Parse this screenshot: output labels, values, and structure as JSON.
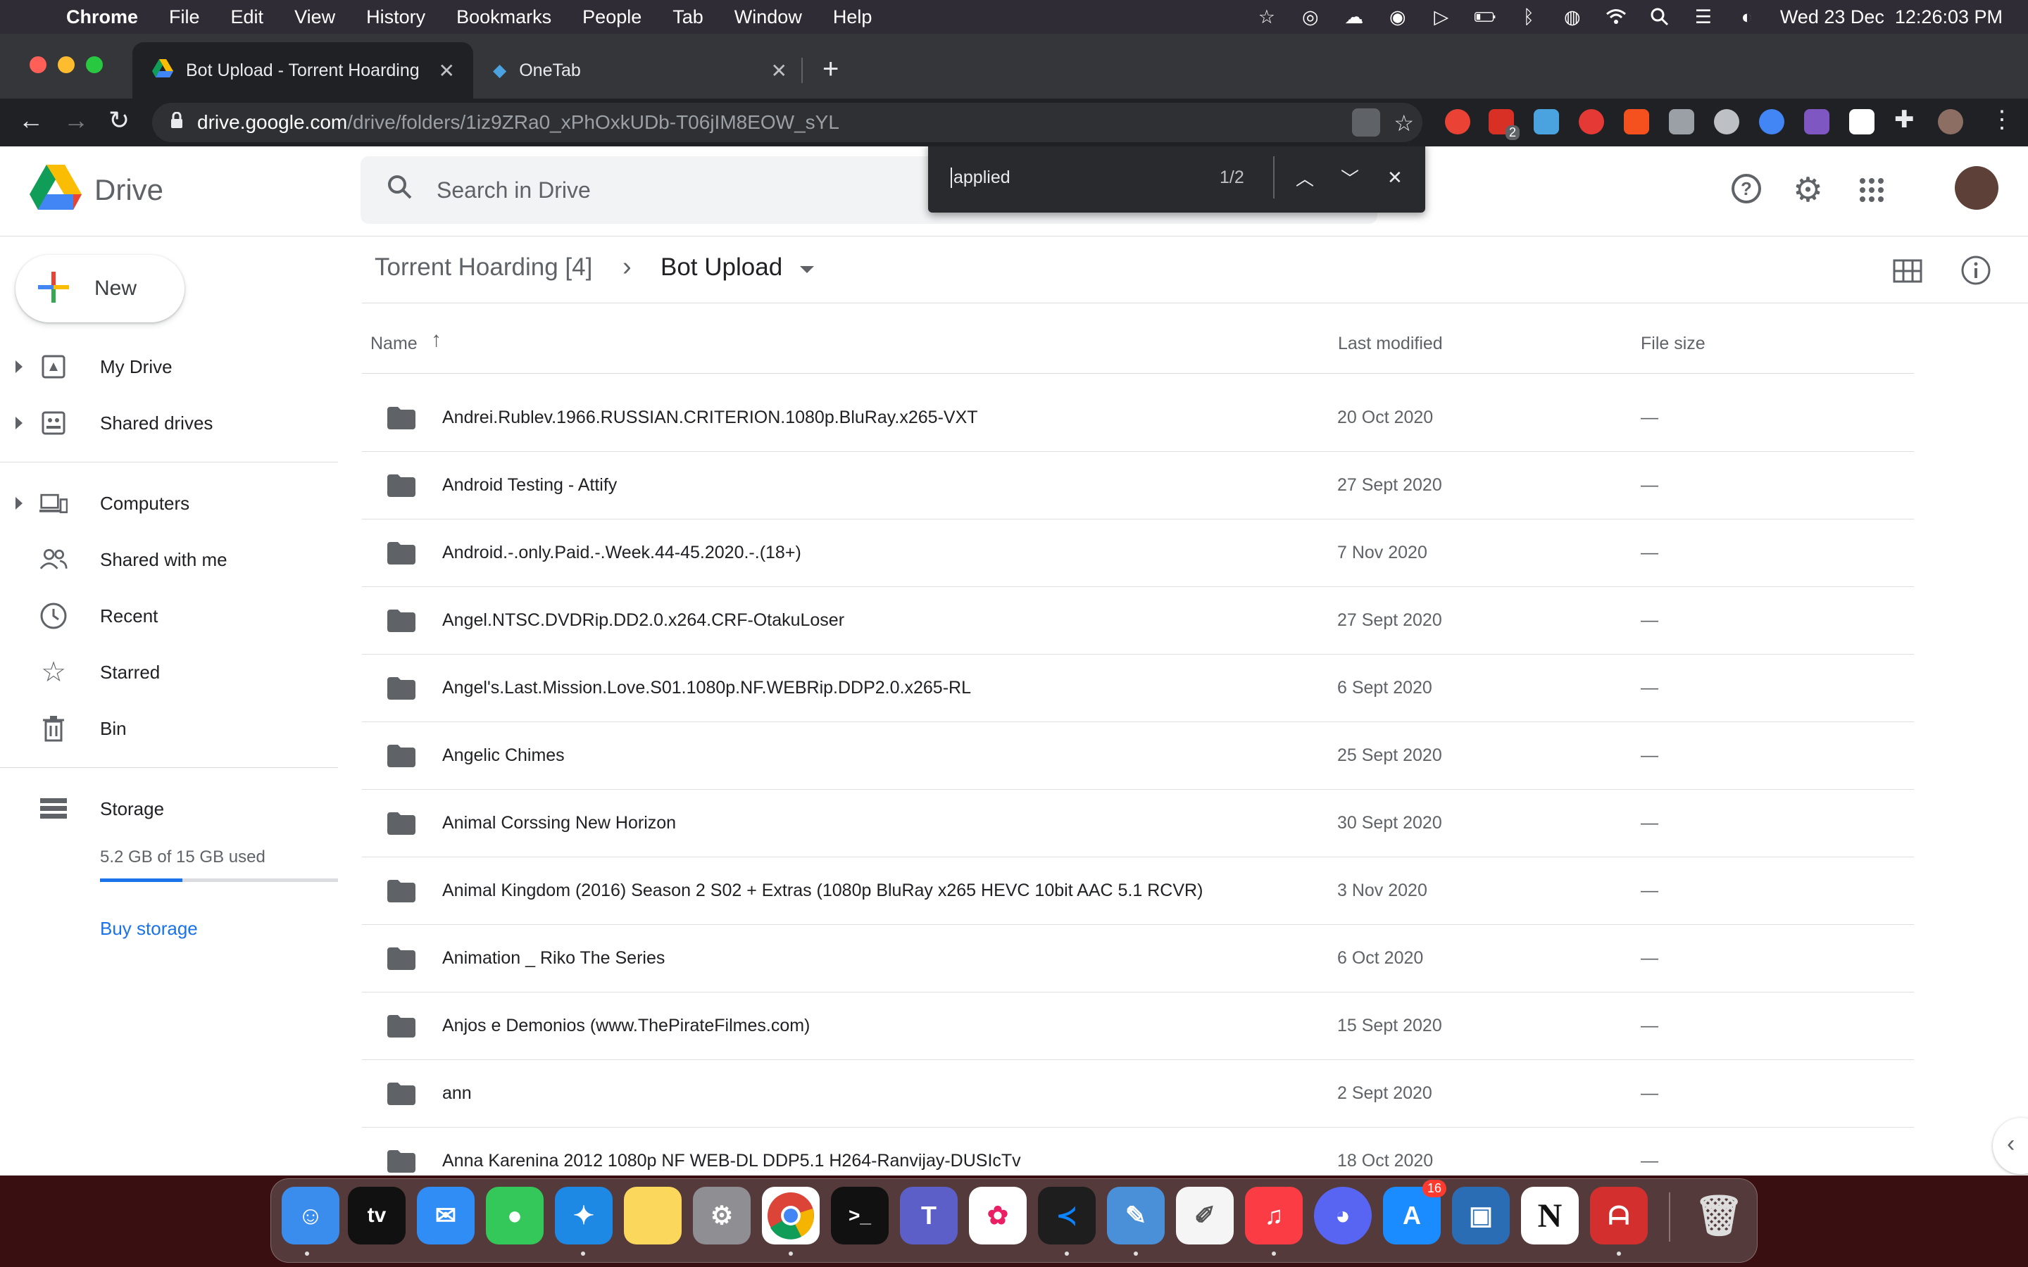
{
  "menubar": {
    "app": "Chrome",
    "items": [
      "File",
      "Edit",
      "View",
      "History",
      "Bookmarks",
      "People",
      "Tab",
      "Window",
      "Help"
    ],
    "clock": "Wed 23 Dec  12:26:03 PM"
  },
  "tabs": [
    {
      "title": "Bot Upload - Torrent Hoarding"
    },
    {
      "title": "OneTab"
    }
  ],
  "omnibox": {
    "host": "drive.google.com",
    "path": "/drive/folders/1iz9ZRa0_xPhOxkUDb-T06jIM8EOW_sYL"
  },
  "extensions": {
    "badge": "2"
  },
  "findbar": {
    "query": "applied",
    "count": "1/2"
  },
  "drive": {
    "brand": "Drive",
    "search_placeholder": "Search in Drive",
    "new_label": "New",
    "nav": {
      "my_drive": "My Drive",
      "shared_drives": "Shared drives",
      "computers": "Computers",
      "shared_with_me": "Shared with me",
      "recent": "Recent",
      "starred": "Starred",
      "bin": "Bin",
      "storage": "Storage"
    },
    "storage": {
      "used_text": "5.2 GB of 15 GB used",
      "used_fraction": 0.347,
      "buy_label": "Buy storage"
    },
    "breadcrumb": {
      "parent": "Torrent Hoarding [4]",
      "current": "Bot Upload"
    },
    "columns": {
      "name": "Name",
      "modified": "Last modified",
      "size": "File size"
    },
    "rows": [
      {
        "name": "Andrei.Rublev.1966.RUSSIAN.CRITERION.1080p.BluRay.x265-VXT",
        "modified": "20 Oct 2020",
        "size": "—"
      },
      {
        "name": "Android Testing - Attify",
        "modified": "27 Sept 2020",
        "size": "—"
      },
      {
        "name": "Android.-.only.Paid.-.Week.44-45.2020.-.(18+)",
        "modified": "7 Nov 2020",
        "size": "—"
      },
      {
        "name": "Angel.NTSC.DVDRip.DD2.0.x264.CRF-OtakuLoser",
        "modified": "27 Sept 2020",
        "size": "—"
      },
      {
        "name": "Angel's.Last.Mission.Love.S01.1080p.NF.WEBRip.DDP2.0.x265-RL",
        "modified": "6 Sept 2020",
        "size": "—"
      },
      {
        "name": "Angelic Chimes",
        "modified": "25 Sept 2020",
        "size": "—"
      },
      {
        "name": "Animal Corssing New Horizon",
        "modified": "30 Sept 2020",
        "size": "—"
      },
      {
        "name": "Animal Kingdom (2016) Season 2 S02 + Extras (1080p BluRay x265 HEVC 10bit AAC 5.1 RCVR)",
        "modified": "3 Nov 2020",
        "size": "—"
      },
      {
        "name": "Animation _ Riko The Series",
        "modified": "6 Oct 2020",
        "size": "—"
      },
      {
        "name": "Anjos e Demonios (www.ThePirateFilmes.com)",
        "modified": "15 Sept 2020",
        "size": "—"
      },
      {
        "name": "ann",
        "modified": "2 Sept 2020",
        "size": "—"
      },
      {
        "name": "Anna Karenina 2012 1080p NF WEB-DL DDP5.1 H264-Ranvijay-DUSIcTv",
        "modified": "18 Oct 2020",
        "size": "—"
      }
    ]
  },
  "dock": {
    "app_store_badge": "16",
    "tv_label": "tv"
  },
  "colors": {
    "drive_blue": "#1a73e8",
    "menubar": "#2f2c35",
    "tab_active": "#202124"
  }
}
